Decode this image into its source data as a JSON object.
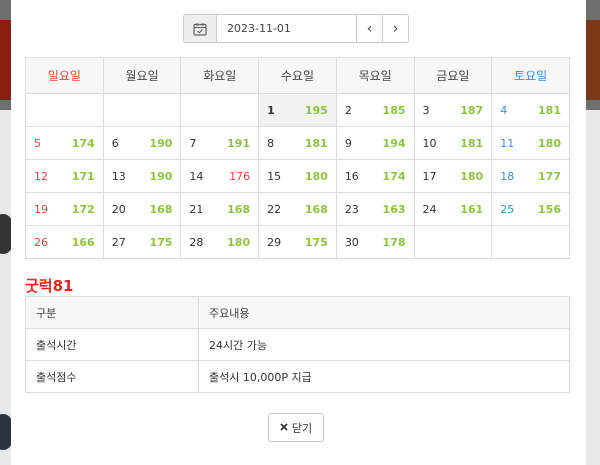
{
  "date_bar": {
    "value": "2023-11-01",
    "prev_icon": "chevron-left-icon",
    "next_icon": "chevron-right-icon",
    "calendar_icon": "calendar-check-icon"
  },
  "calendar": {
    "weekdays": [
      "일요일",
      "월요일",
      "화요일",
      "수요일",
      "목요일",
      "금요일",
      "토요일"
    ],
    "weeks": [
      [
        {
          "day": "",
          "count": ""
        },
        {
          "day": "",
          "count": ""
        },
        {
          "day": "",
          "count": ""
        },
        {
          "day": "1",
          "count": "195"
        },
        {
          "day": "2",
          "count": "185"
        },
        {
          "day": "3",
          "count": "187"
        },
        {
          "day": "4",
          "count": "181"
        }
      ],
      [
        {
          "day": "5",
          "count": "174"
        },
        {
          "day": "6",
          "count": "190"
        },
        {
          "day": "7",
          "count": "191"
        },
        {
          "day": "8",
          "count": "181"
        },
        {
          "day": "9",
          "count": "194"
        },
        {
          "day": "10",
          "count": "181"
        },
        {
          "day": "11",
          "count": "180"
        }
      ],
      [
        {
          "day": "12",
          "count": "171"
        },
        {
          "day": "13",
          "count": "190"
        },
        {
          "day": "14",
          "count": "176"
        },
        {
          "day": "15",
          "count": "180"
        },
        {
          "day": "16",
          "count": "174"
        },
        {
          "day": "17",
          "count": "180"
        },
        {
          "day": "18",
          "count": "177"
        }
      ],
      [
        {
          "day": "19",
          "count": "172"
        },
        {
          "day": "20",
          "count": "168"
        },
        {
          "day": "21",
          "count": "168"
        },
        {
          "day": "22",
          "count": "168"
        },
        {
          "day": "23",
          "count": "163"
        },
        {
          "day": "24",
          "count": "161"
        },
        {
          "day": "25",
          "count": "156"
        }
      ],
      [
        {
          "day": "26",
          "count": "166"
        },
        {
          "day": "27",
          "count": "175"
        },
        {
          "day": "28",
          "count": "180"
        },
        {
          "day": "29",
          "count": "175"
        },
        {
          "day": "30",
          "count": "178"
        },
        {
          "day": "",
          "count": ""
        },
        {
          "day": "",
          "count": ""
        }
      ]
    ],
    "colors": {
      "sunday": "#e8443a",
      "saturday": "#3a8ee0",
      "count": "#8cc63f"
    }
  },
  "site": {
    "name": "굿럭81"
  },
  "info_table": {
    "headers": [
      "구분",
      "주요내용"
    ],
    "rows": [
      [
        "출석시간",
        "24시간 가능"
      ],
      [
        "출석점수",
        "출석시 10,000P 지급"
      ]
    ]
  },
  "close_button": {
    "label": "닫기",
    "icon": "close-icon"
  }
}
